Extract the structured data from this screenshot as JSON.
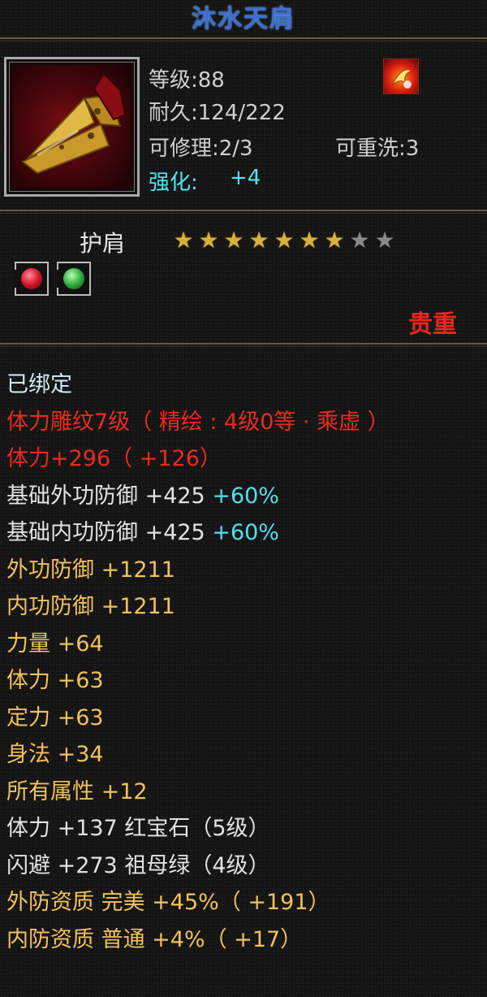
{
  "item": {
    "name": "沐水天肩",
    "level": "等级:88",
    "durability": "耐久:124/222",
    "repairable": "可修理:2/3",
    "rewashable": "可重洗:3",
    "enhance_label": "强化:",
    "enhance_value": "+4",
    "type": "护肩",
    "stars_filled": 7,
    "stars_total": 9,
    "rarity": "贵重"
  },
  "stars": [
    "on",
    "on",
    "on",
    "on",
    "on",
    "on",
    "on",
    "off",
    "off"
  ],
  "gems": [
    {
      "name": "red-gem",
      "color": "red"
    },
    {
      "name": "green-gem",
      "color": "green"
    }
  ],
  "attributes": [
    {
      "parts": [
        {
          "text": "已绑定",
          "cls": "c-bound"
        }
      ]
    },
    {
      "parts": [
        {
          "text": "体力雕纹7级（ 精绘 : 4级0等 · 乘虚 ）",
          "cls": "c-red"
        }
      ]
    },
    {
      "parts": [
        {
          "text": "体力+296（ +126）",
          "cls": "c-red"
        }
      ]
    },
    {
      "parts": [
        {
          "text": "基础外功防御  +425 ",
          "cls": "c-white"
        },
        {
          "text": "+60%",
          "cls": "c-cyan"
        }
      ]
    },
    {
      "parts": [
        {
          "text": "基础内功防御  +425 ",
          "cls": "c-white"
        },
        {
          "text": "+60%",
          "cls": "c-cyan"
        }
      ]
    },
    {
      "parts": [
        {
          "text": "外功防御  +1211",
          "cls": "c-orange"
        }
      ]
    },
    {
      "parts": [
        {
          "text": "内功防御  +1211",
          "cls": "c-orange"
        }
      ]
    },
    {
      "parts": [
        {
          "text": "力量  +64",
          "cls": "c-orange"
        }
      ]
    },
    {
      "parts": [
        {
          "text": "体力  +63",
          "cls": "c-orange"
        }
      ]
    },
    {
      "parts": [
        {
          "text": "定力  +63",
          "cls": "c-orange"
        }
      ]
    },
    {
      "parts": [
        {
          "text": "身法  +34",
          "cls": "c-orange"
        }
      ]
    },
    {
      "parts": [
        {
          "text": "所有属性  +12",
          "cls": "c-orange"
        }
      ]
    },
    {
      "parts": [
        {
          "text": "体力  +137  红宝石（5级）",
          "cls": "c-white"
        }
      ]
    },
    {
      "parts": [
        {
          "text": "闪避  +273  祖母绿（4级）",
          "cls": "c-white"
        }
      ]
    },
    {
      "parts": [
        {
          "text": "外防资质    完美  +45%（ +191）",
          "cls": "c-orange"
        }
      ]
    },
    {
      "parts": [
        {
          "text": "内防资质    普通  +4%（ +17）",
          "cls": "c-orange"
        }
      ]
    }
  ],
  "colors": {
    "title": "#3a6fd0",
    "enhance": "#4fe6ef",
    "rarity": "#e8281a",
    "star_on": "#d9b13a",
    "star_off": "#8a8a8a"
  }
}
